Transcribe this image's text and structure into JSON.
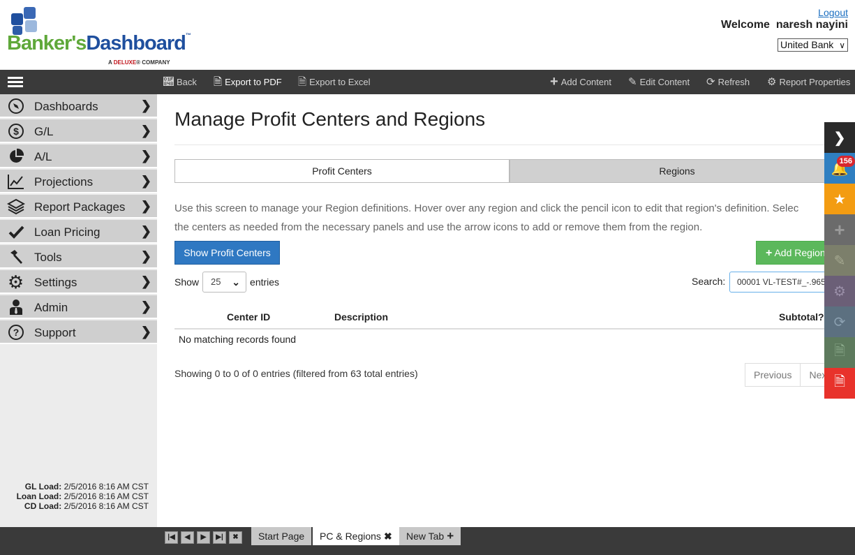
{
  "header": {
    "logo_text_1": "Banker's",
    "logo_text_2": "Dashboard",
    "logo_tm": "™",
    "logo_sub_prefix": "A ",
    "logo_sub_brand": "DELUXE",
    "logo_sub_suffix": "® COMPANY",
    "logout": "Logout",
    "welcome_label": "Welcome",
    "user_name": "naresh nayini",
    "bank": "United Bank"
  },
  "toolbar": {
    "back": "Back",
    "export_pdf": "Export to PDF",
    "export_excel": "Export to Excel",
    "add_content": "Add Content",
    "edit_content": "Edit Content",
    "refresh": "Refresh",
    "report_properties": "Report Properties"
  },
  "sidebar": {
    "items": [
      {
        "label": "Dashboards",
        "icon": "compass-icon"
      },
      {
        "label": "G/L",
        "icon": "dollar-icon"
      },
      {
        "label": "A/L",
        "icon": "pie-chart-icon"
      },
      {
        "label": "Projections",
        "icon": "line-chart-icon"
      },
      {
        "label": "Report Packages",
        "icon": "layers-icon"
      },
      {
        "label": "Loan Pricing",
        "icon": "check-icon"
      },
      {
        "label": "Tools",
        "icon": "hammer-icon"
      },
      {
        "label": "Settings",
        "icon": "gear-icon"
      },
      {
        "label": "Admin",
        "icon": "user-tie-icon"
      },
      {
        "label": "Support",
        "icon": "question-icon"
      }
    ],
    "loads": [
      {
        "label": "GL Load:",
        "value": "2/5/2016 8:16 AM CST"
      },
      {
        "label": "Loan Load:",
        "value": "2/5/2016 8:16 AM CST"
      },
      {
        "label": "CD Load:",
        "value": "2/5/2016 8:16 AM CST"
      }
    ]
  },
  "main": {
    "title": "Manage Profit Centers and Regions",
    "tabs": [
      {
        "label": "Profit Centers"
      },
      {
        "label": "Regions"
      }
    ],
    "intro_line1": "Use this screen to manage your Region definitions. Hover over any region and click the pencil icon to edit that region's definition. Selec",
    "intro_line2": "the centers as needed from the necessary panels and use the arrow icons to add or remove them from the region.",
    "show_profit_centers": "Show Profit Centers",
    "add_region": "Add Region",
    "show_label": "Show",
    "page_length": "25",
    "entries_label": "entries",
    "search_label": "Search:",
    "search_value": "00001 VL-TEST#_-.965",
    "columns": [
      "Center ID",
      "Description",
      "Subtotal?"
    ],
    "empty_message": "No matching records found",
    "info": "Showing 0 to 0 of 0 entries (filtered from 63 total entries)",
    "previous": "Previous",
    "next": "Nex"
  },
  "rail": {
    "notification_count": "156",
    "colors": [
      "#2a2a2a",
      "#2f7fc1",
      "#f39c12",
      "#6b6b6b",
      "#7c7f6b",
      "#6b5f77",
      "#5c7080",
      "#5d7a5d",
      "#e8322b"
    ]
  },
  "bottombar": {
    "tabs": [
      {
        "label": "Start Page"
      },
      {
        "label": "PC & Regions"
      },
      {
        "label": "New Tab"
      }
    ]
  }
}
